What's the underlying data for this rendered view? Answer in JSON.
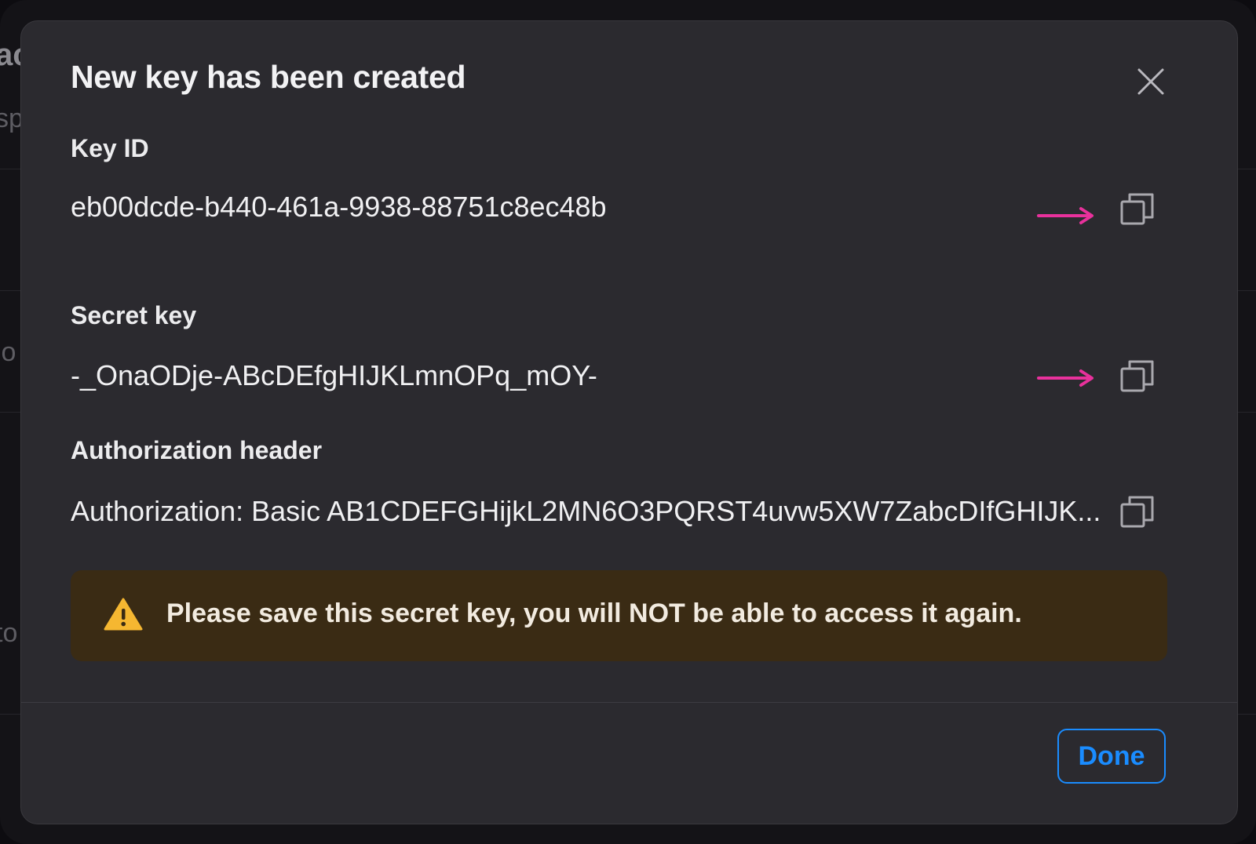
{
  "background": {
    "fragments": [
      "ac",
      "sp",
      "io",
      "to"
    ]
  },
  "modal": {
    "title": "New key has been created",
    "close_icon": "close-icon",
    "key_id": {
      "label": "Key ID",
      "value": "eb00dcde-b440-461a-9938-88751c8ec48b"
    },
    "secret_key": {
      "label": "Secret key",
      "value": "-_OnaODje-ABcDEfgHIJKLmnOPq_mOY-"
    },
    "authorization_header": {
      "label": "Authorization header",
      "value": "Authorization: Basic AB1CDEFGHijkL2MN6O3PQRST4uvw5XW7ZabcDIfGHIJK..."
    },
    "warning": {
      "icon": "warning-icon",
      "text": "Please save this secret key, you will NOT be able to access it again."
    },
    "done_label": "Done"
  },
  "colors": {
    "modal_bg": "#2b2a2f",
    "warning_bg": "#3a2b14",
    "warning_icon": "#f5b731",
    "accent": "#1a8cff",
    "annotation_arrow": "#e8319c"
  }
}
